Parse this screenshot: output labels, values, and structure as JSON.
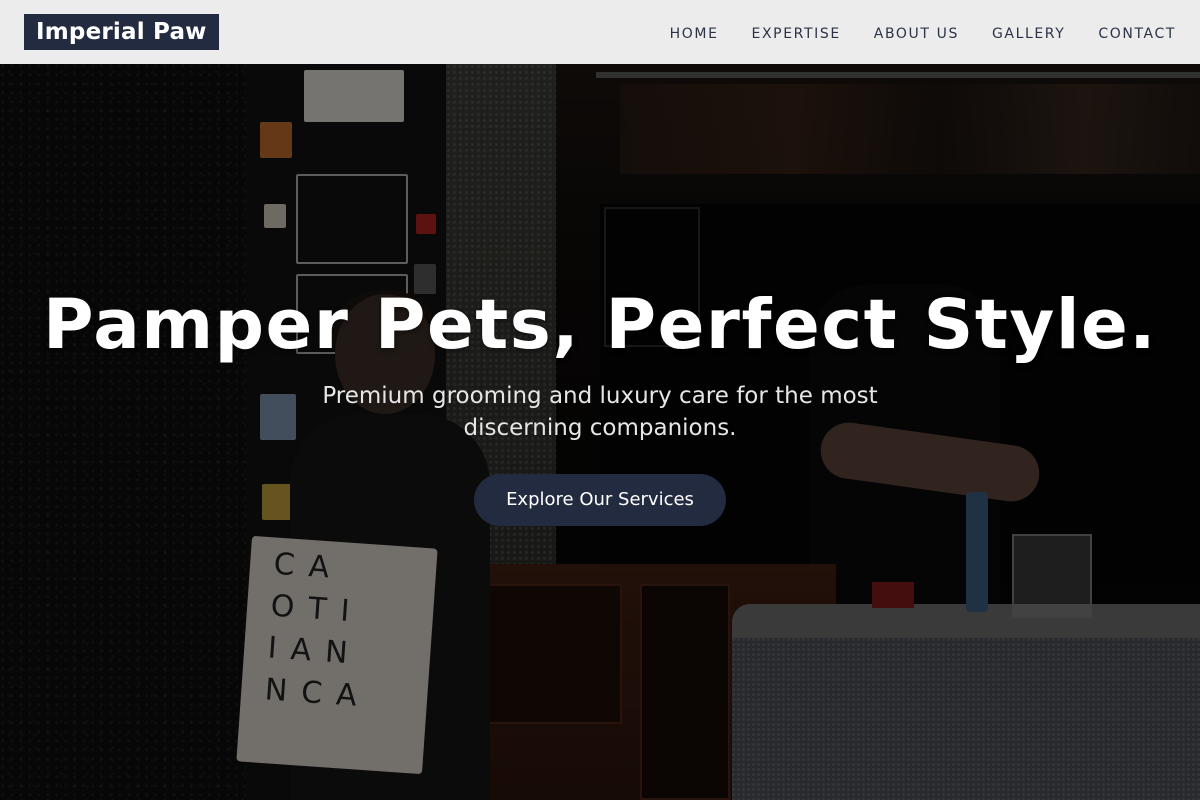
{
  "header": {
    "logo_text": "Imperial Paw",
    "nav": [
      {
        "label": "HOME"
      },
      {
        "label": "EXPERTISE"
      },
      {
        "label": "ABOUT US"
      },
      {
        "label": "GALLERY"
      },
      {
        "label": "CONTACT"
      }
    ]
  },
  "hero": {
    "title": "Pamper Pets, Perfect Style.",
    "subtitle": "Premium grooming and luxury care for the most discerning companions.",
    "cta_label": "Explore Our Services",
    "tote_letters": "CA OTI IAN NCA"
  },
  "colors": {
    "brand_navy": "#232b40",
    "nav_background": "#ececec",
    "text_white": "#ffffff"
  }
}
